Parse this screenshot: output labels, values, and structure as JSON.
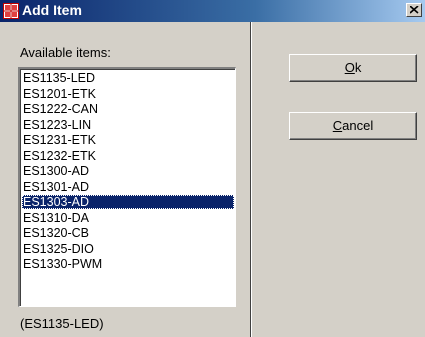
{
  "window": {
    "title": "Add Item",
    "close_icon": "close-icon",
    "title_icon": "add-item-icon"
  },
  "left": {
    "label": "Available items:",
    "items": [
      "ES1135-LED",
      "ES1201-ETK",
      "ES1222-CAN",
      "ES1223-LIN",
      "ES1231-ETK",
      "ES1232-ETK",
      "ES1300-AD",
      "ES1301-AD",
      "ES1303-AD",
      "ES1310-DA",
      "ES1320-CB",
      "ES1325-DIO",
      "ES1330-PWM"
    ],
    "selected_item": "ES1303-AD",
    "status": "(ES1135-LED)"
  },
  "buttons": {
    "ok_label": "Ok",
    "cancel_label": "Cancel"
  },
  "colors": {
    "title_start": "#0a246a",
    "title_end": "#a6caf0",
    "selection": "#0a246a",
    "face": "#d4d0c8"
  }
}
